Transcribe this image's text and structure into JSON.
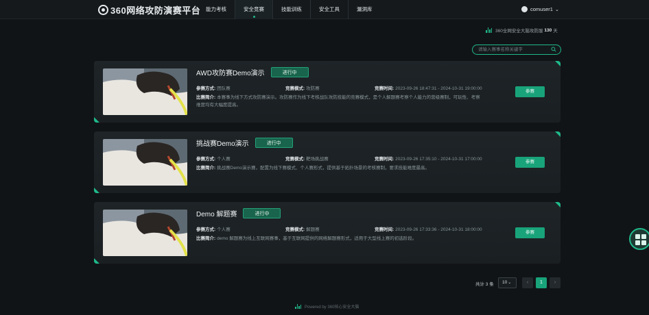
{
  "brand": {
    "name": "360网络攻防演赛平台"
  },
  "nav": {
    "items": [
      {
        "label": "能力考核"
      },
      {
        "label": "安全竞赛"
      },
      {
        "label": "技能训练"
      },
      {
        "label": "安全工具"
      },
      {
        "label": "漏洞库"
      }
    ],
    "active_index": 1
  },
  "user": {
    "name": "comuser1"
  },
  "streak": {
    "prefix": "360全网安全大脑攻防服",
    "days": "130",
    "unit": "天"
  },
  "search": {
    "placeholder": "请输入赛事名称关键字"
  },
  "labels": {
    "mode": "参赛方式:",
    "form": "竞赛模式:",
    "time": "竞赛时间:",
    "intro": "比赛简介:",
    "join": "参赛"
  },
  "competitions": [
    {
      "title": "AWD攻防赛Demo演示",
      "status": "进行中",
      "mode": "团队赛",
      "form": "攻防赛",
      "time": "2023-09-26 18:47:31 - 2024-10-31 19:00:00",
      "intro": "本赛事为线下方式攻防赛演示。攻防赛作为线下考核战队攻防技能的竞赛模式，是个人解题赛考察个人能力的营级赛制，可玩性、考察维度均有大幅度提高。"
    },
    {
      "title": "挑战赛Demo演示",
      "status": "进行中",
      "mode": "个人赛",
      "form": "靶场挑战赛",
      "time": "2023-09-26 17:35:10 - 2024-10-31 17:00:00",
      "intro": "挑战赛Demo演示赛，配置为线下赛模式、个人赛形式，提供基于拓扑场景的考核赛制，要求技能难度最高。"
    },
    {
      "title": "Demo 解题赛",
      "status": "进行中",
      "mode": "个人赛",
      "form": "解题赛",
      "time": "2023-09-26 17:33:36 - 2024-10-31 18:00:00",
      "intro": "demo 解题赛为线上互联网赛事，基于互联网提供的网络解题赛形式，适用于大型线上赛的初选阶段。"
    }
  ],
  "pagination": {
    "total": "共计 3 条",
    "page_size": "10",
    "current": "1",
    "prev": "‹",
    "next": "›"
  },
  "footer": {
    "text": "Powered by 360核心安全大脑"
  },
  "colors": {
    "accent": "#1fb98a",
    "button": "#19a37a",
    "status_bg": "#19644c",
    "background": "#111417",
    "card": "#1c2124"
  },
  "icons": [
    "logo-icon",
    "user-icon",
    "chevron-down-icon",
    "search-icon",
    "pulse-icon",
    "grid-icon"
  ]
}
